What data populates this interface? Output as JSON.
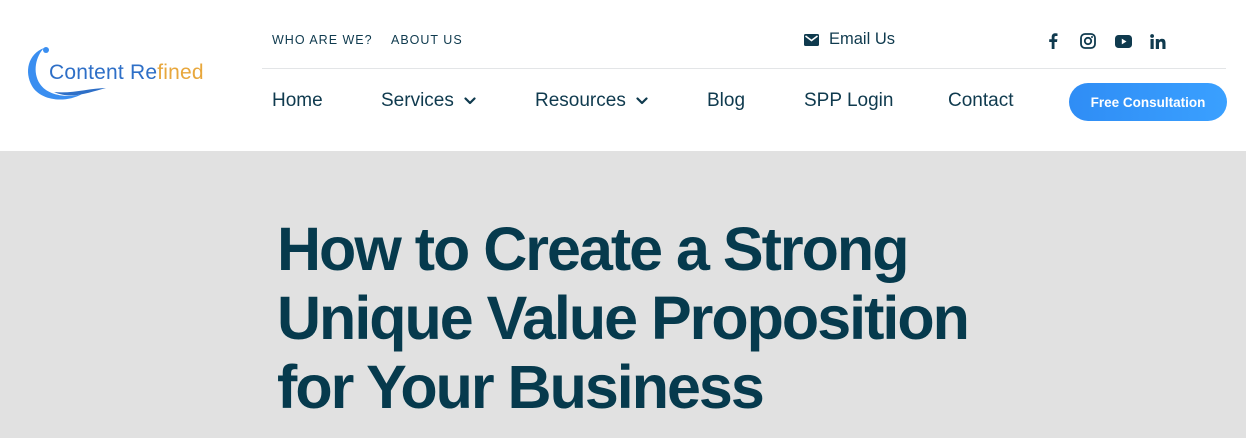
{
  "brand": {
    "name_part1": "Content Re",
    "name_part2": "fined",
    "color_blue": "#2e6fc7",
    "color_gold": "#e8a73c"
  },
  "topbar": {
    "links": [
      {
        "label": "WHO ARE WE?"
      },
      {
        "label": "ABOUT US"
      }
    ],
    "email_label": "Email Us",
    "email_icon": "envelope-icon",
    "social": [
      "facebook-icon",
      "instagram-icon",
      "youtube-icon",
      "linkedin-icon"
    ]
  },
  "nav": {
    "items": [
      {
        "label": "Home",
        "has_dropdown": false
      },
      {
        "label": "Services",
        "has_dropdown": true
      },
      {
        "label": "Resources",
        "has_dropdown": true
      },
      {
        "label": "Blog",
        "has_dropdown": false
      },
      {
        "label": "SPP Login",
        "has_dropdown": false
      },
      {
        "label": "Contact",
        "has_dropdown": false
      }
    ],
    "cta_label": "Free Consultation",
    "cta_color": "#2f8df5"
  },
  "hero": {
    "title": "How to Create a Strong Unique Value Proposition for Your Business",
    "background": "#e1e1e1",
    "text_color": "#063a4d"
  }
}
